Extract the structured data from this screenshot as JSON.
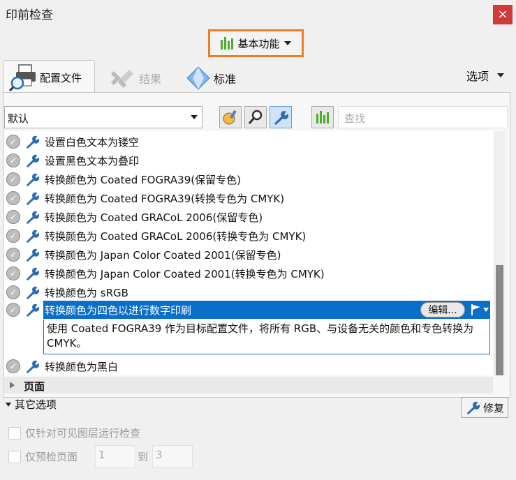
{
  "window": {
    "title": "印前检查",
    "close_glyph": "×"
  },
  "feature_menu": {
    "label": "基本功能",
    "icon": "bars-icon",
    "accent": "#ef7d22"
  },
  "tabs": [
    {
      "label": "配置文件",
      "icon": "printer-magnifier-icon",
      "active": true
    },
    {
      "label": "结果",
      "icon": "results-icon",
      "active": false
    },
    {
      "label": "标准",
      "icon": "standards-diamond-icon",
      "active": false
    }
  ],
  "options_menu": {
    "label": "选项"
  },
  "toolbar": {
    "profile_value": "默认",
    "find_placeholder": "查找"
  },
  "list": {
    "items": [
      {
        "label": "设置白色文本为镂空"
      },
      {
        "label": "设置黑色文本为叠印"
      },
      {
        "label": "转换颜色为 Coated FOGRA39(保留专色)"
      },
      {
        "label": "转换颜色为 Coated FOGRA39(转换专色为 CMYK)"
      },
      {
        "label": "转换颜色为 Coated GRACoL 2006(保留专色)"
      },
      {
        "label": "转换颜色为 Coated GRACoL 2006(转换专色为 CMYK)"
      },
      {
        "label": "转换颜色为 Japan Color Coated 2001(保留专色)"
      },
      {
        "label": "转换颜色为 Japan Color Coated 2001(转换专色为 CMYK)"
      },
      {
        "label": "转换颜色为 sRGB"
      }
    ],
    "selected": {
      "label": "转换颜色为四色以进行数字印刷",
      "edit_label": "编辑...",
      "description": "使用 Coated FOGRA39 作为目标配置文件，将所有 RGB、与设备无关的颜色和专色转换为 CMYK。"
    },
    "after": [
      {
        "label": "转换颜色为黑白"
      }
    ],
    "section": {
      "label": "页面"
    }
  },
  "other_options": {
    "label": "其它选项",
    "fix_label": "修复",
    "visible_layers_label": "仅针对可见图层运行检查",
    "preflight_pages_label": "仅预检页面",
    "page_from": "1",
    "to_label": "到",
    "page_to": "3"
  },
  "colors": {
    "selection": "#0a6fc8",
    "close": "#d23a3a",
    "green": "#4cad2b"
  }
}
